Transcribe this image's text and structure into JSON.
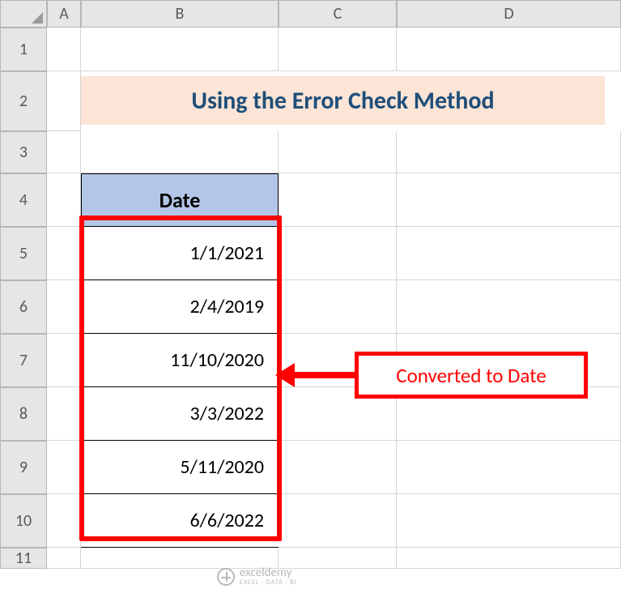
{
  "columns": [
    "A",
    "B",
    "C",
    "D"
  ],
  "rows": [
    "1",
    "2",
    "3",
    "4",
    "5",
    "6",
    "7",
    "8",
    "9",
    "10",
    "11"
  ],
  "title": "Using the Error Check Method",
  "table": {
    "header": "Date",
    "values": [
      "1/1/2021",
      "2/4/2019",
      "11/10/2020",
      "3/3/2022",
      "5/11/2020",
      "6/6/2022"
    ]
  },
  "callout": "Converted to Date",
  "colors": {
    "title_bg": "#fce4d6",
    "title_fg": "#1f4e79",
    "header_bg": "#b4c6e7",
    "accent": "#ff0000"
  },
  "watermark": {
    "brand": "exceldemy",
    "tagline": "EXCEL · DATA · BI"
  }
}
